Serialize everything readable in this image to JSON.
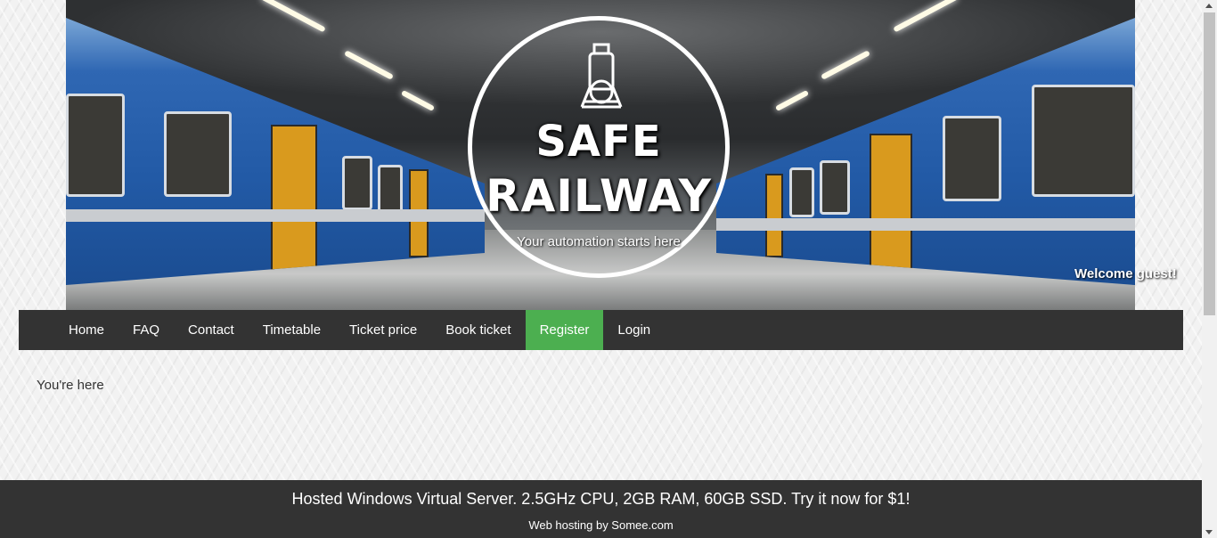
{
  "banner": {
    "logo_title_line1": "SAFE",
    "logo_title_line2": "RAILWAY",
    "tagline": "Your automation starts here",
    "logo_icon": "train-icon",
    "welcome_text": "Welcome guest!"
  },
  "menu": {
    "items": [
      {
        "label": "Home"
      },
      {
        "label": "FAQ"
      },
      {
        "label": "Contact"
      },
      {
        "label": "Timetable"
      },
      {
        "label": "Ticket price"
      },
      {
        "label": "Book ticket"
      },
      {
        "label": "Register"
      },
      {
        "label": "Login"
      }
    ],
    "active": "Register",
    "active_color": "#4caf50",
    "bar_color": "#333333"
  },
  "content": {
    "breadcrumb": "You're here"
  },
  "footer": {
    "main": "Hosted Windows Virtual Server. 2.5GHz CPU, 2GB RAM, 60GB SSD. Try it now for $1!",
    "sub": "Web hosting by Somee.com"
  }
}
